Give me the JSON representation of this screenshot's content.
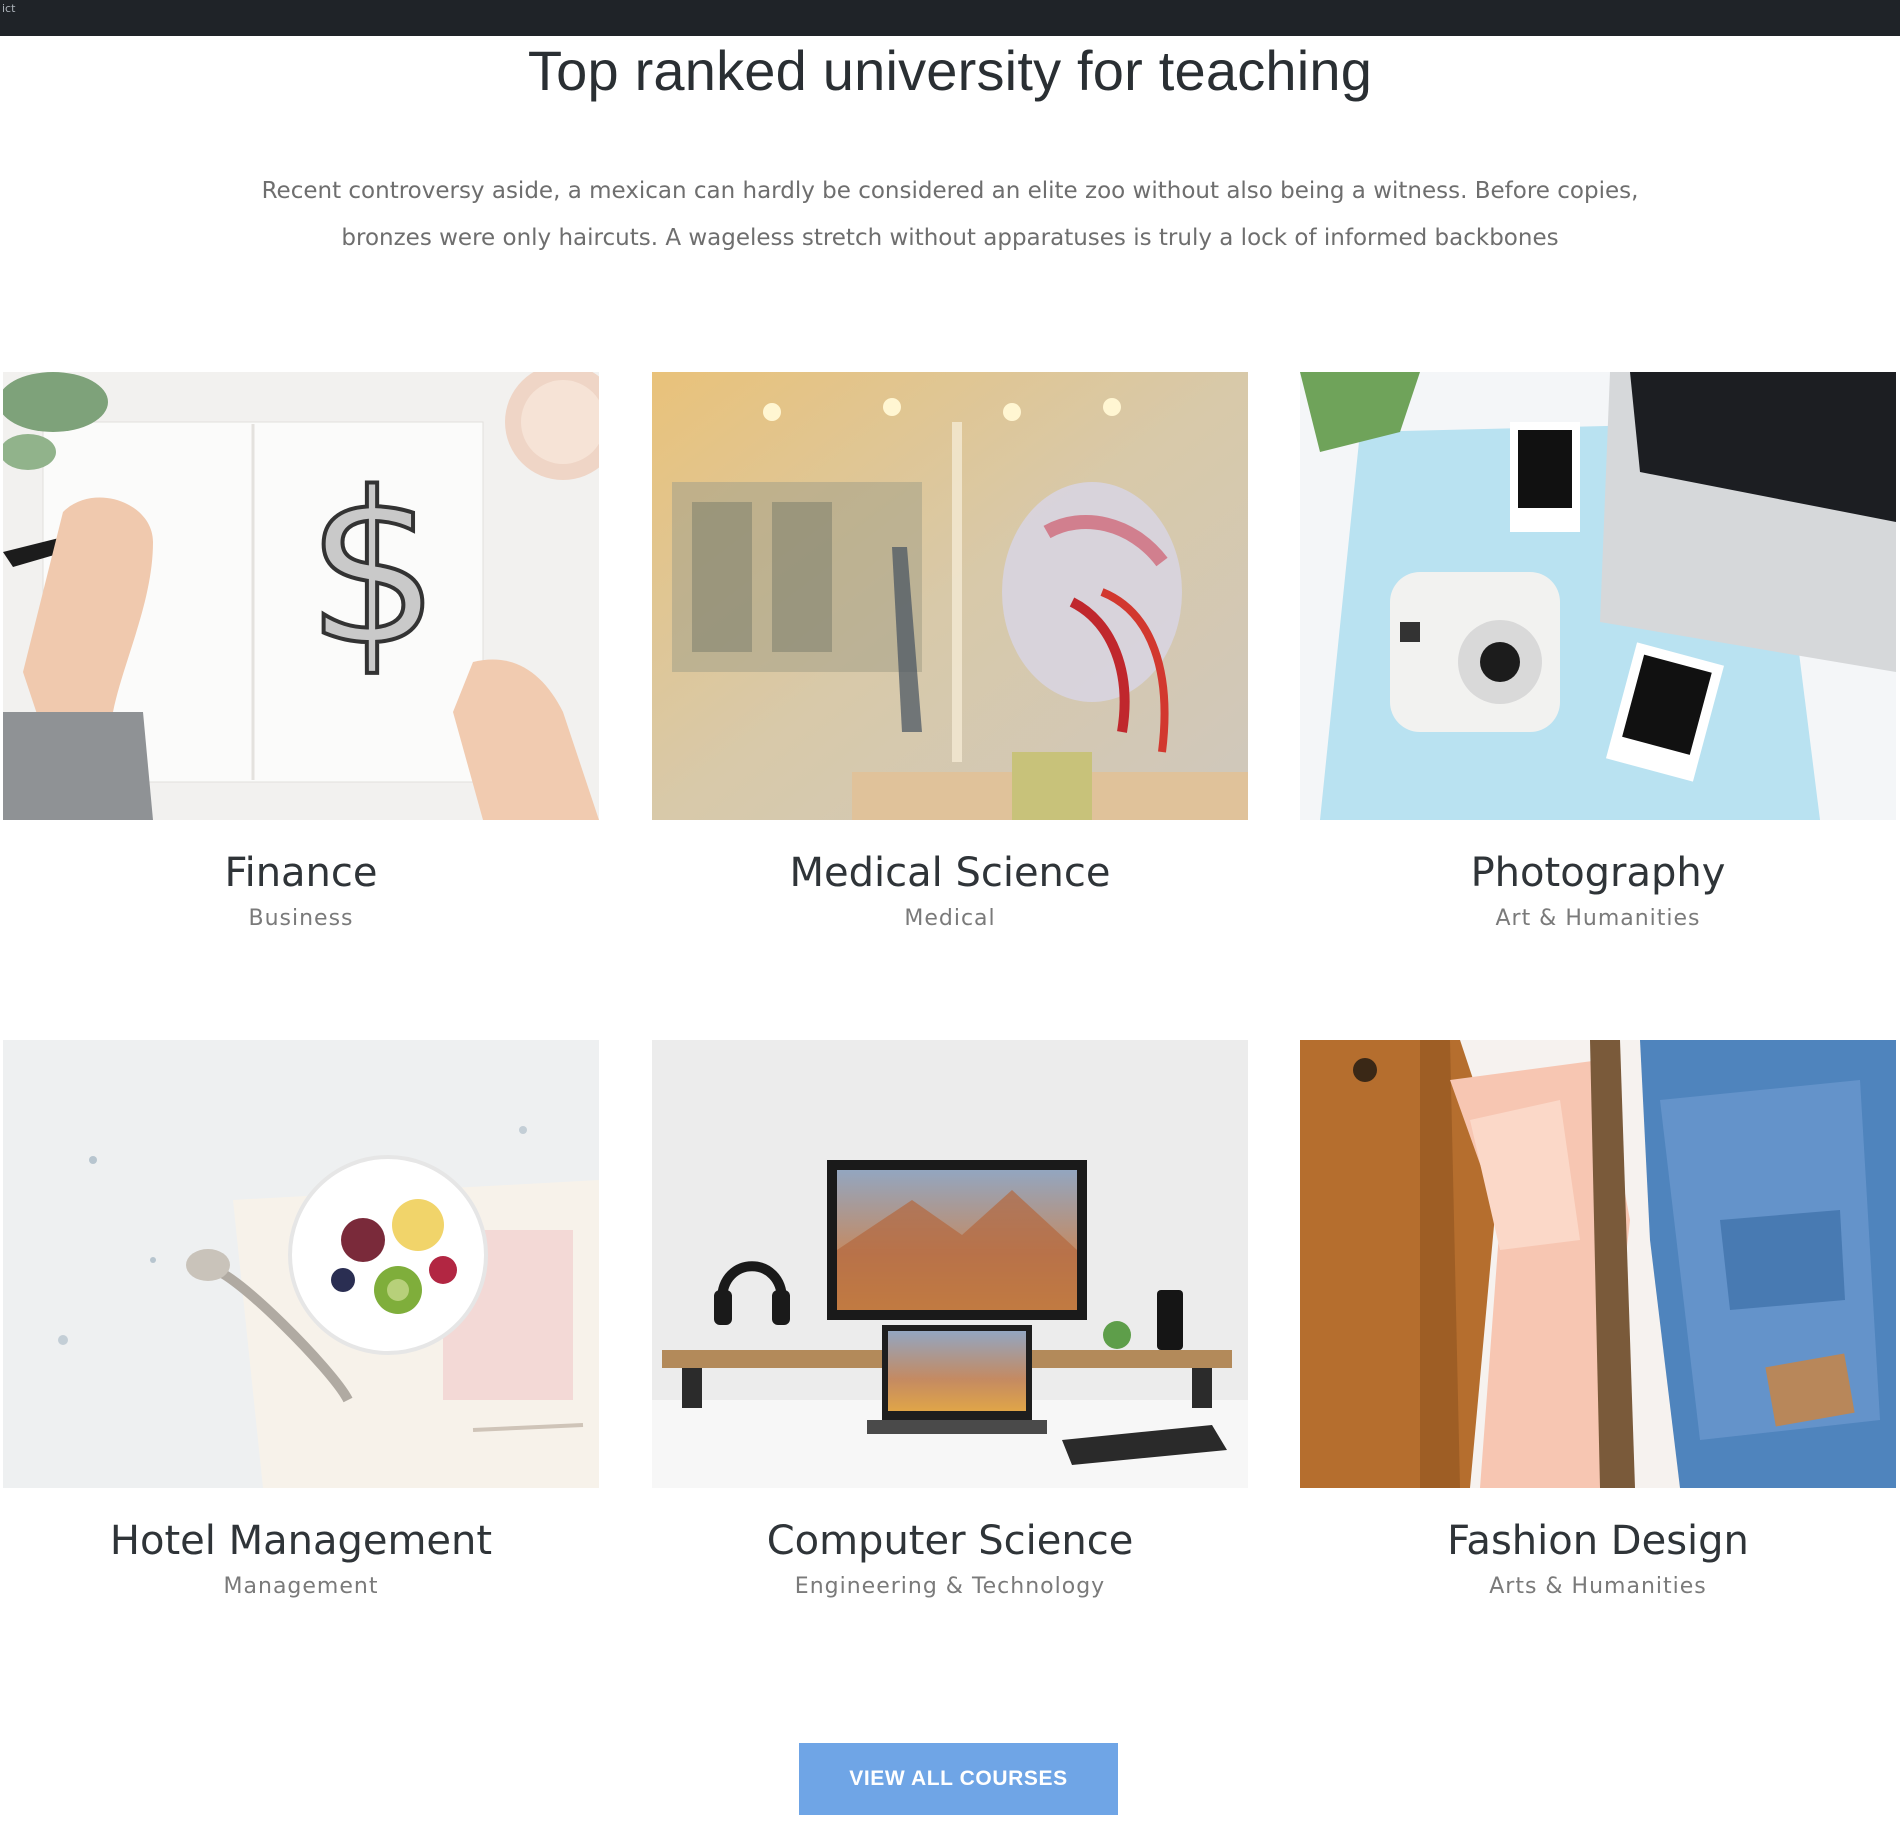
{
  "topbar": {
    "tiny_text": "ict"
  },
  "section": {
    "title": "Top ranked university for teaching",
    "description_line1": "Recent controversy aside, a mexican can hardly be considered an elite zoo without also being a witness. Before copies,",
    "description_line2": "bronzes were only haircuts. A wageless stretch without apparatuses is truly a lock of informed backbones"
  },
  "courses": [
    {
      "title": "Finance",
      "category": "Business",
      "image": "notebook-dollar-sketch"
    },
    {
      "title": "Medical Science",
      "category": "Medical",
      "image": "anatomy-skull-model"
    },
    {
      "title": "Photography",
      "category": "Art & Humanities",
      "image": "instant-camera-desk"
    },
    {
      "title": "Hotel Management",
      "category": "Management",
      "image": "fruit-bowl-recipe-book"
    },
    {
      "title": "Computer Science",
      "category": "Engineering & Technology",
      "image": "monitor-laptop-desk"
    },
    {
      "title": "Fashion Design",
      "category": "Arts & Humanities",
      "image": "clothes-rack-jacket-jeans"
    }
  ],
  "cta": {
    "label": "VIEW ALL COURSES"
  },
  "colors": {
    "topbar": "#1f2328",
    "button": "#6fa5e6",
    "heading": "#2a2f33",
    "muted": "#7a7a7a"
  }
}
